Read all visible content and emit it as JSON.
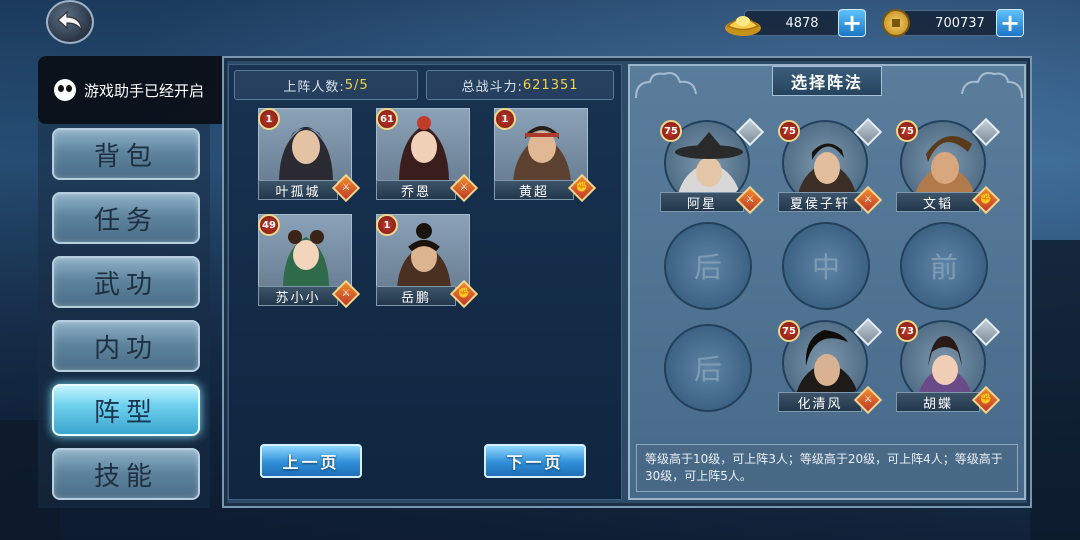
{
  "currency": {
    "ingot_amount": "4878",
    "coin_amount": "700737",
    "plus_label": "+"
  },
  "assistant": {
    "text": "游戏助手已经开启"
  },
  "menu": {
    "items": [
      {
        "label": "背包"
      },
      {
        "label": "任务"
      },
      {
        "label": "武功"
      },
      {
        "label": "内功"
      },
      {
        "label": "阵型",
        "active": true
      },
      {
        "label": "技能"
      }
    ]
  },
  "stats": {
    "members_label": "上阵人数:",
    "members_value": "5/5",
    "power_label": "总战斗力:",
    "power_value": "621351"
  },
  "roster": [
    {
      "name": "叶孤城",
      "level": "1"
    },
    {
      "name": "乔恩",
      "level": "61"
    },
    {
      "name": "黄超",
      "level": "1"
    },
    {
      "name": "苏小小",
      "level": "49"
    },
    {
      "name": "岳鹏",
      "level": "1"
    }
  ],
  "pagination": {
    "prev": "上一页",
    "next": "下一页"
  },
  "formation": {
    "title": "选择阵法",
    "placed": [
      {
        "name": "阿星",
        "level": "75"
      },
      {
        "name": "夏侯子轩",
        "level": "75"
      },
      {
        "name": "文韬",
        "level": "75"
      },
      {
        "name": "化清风",
        "level": "75"
      },
      {
        "name": "胡蝶",
        "level": "73"
      }
    ],
    "empty_slots": [
      {
        "label": "后"
      },
      {
        "label": "中"
      },
      {
        "label": "前"
      },
      {
        "label": "后"
      }
    ],
    "tip": "等级高于10级，可上阵3人；等级高于20级，可上阵4人；等级高于30级，可上阵5人。"
  },
  "colors": {
    "accent_gold": "#f4d34a",
    "active_menu": "#6fd1ee",
    "level_badge": "#c0392b"
  }
}
